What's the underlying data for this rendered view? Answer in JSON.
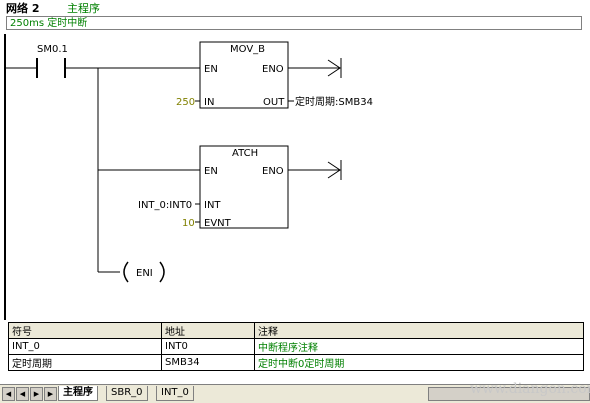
{
  "network": {
    "label": "网络 2",
    "name": "主程序",
    "comment": "250ms 定时中断"
  },
  "rungs": {
    "contact": "SM0.1",
    "mov": {
      "title": "MOV_B",
      "en": "EN",
      "eno": "ENO",
      "in": "IN",
      "out": "OUT",
      "in_value": "250",
      "out_value": "定时周期:SMB34"
    },
    "atch": {
      "title": "ATCH",
      "en": "EN",
      "eno": "ENO",
      "int": "INT",
      "evnt": "EVNT",
      "int_value": "INT_0:INT0",
      "evnt_value": "10"
    },
    "eni": "ENI"
  },
  "symbol_table": {
    "headers": [
      "符号",
      "地址",
      "注释"
    ],
    "rows": [
      [
        "INT_0",
        "INT0",
        "中断程序注释"
      ],
      [
        "定时周期",
        "SMB34",
        "定时中断0定时周期"
      ]
    ]
  },
  "tabs": [
    "主程序",
    "SBR_0",
    "INT_0"
  ],
  "watermark": "www.diangon.com",
  "colors": {
    "comment": "#008000",
    "constant": "#808000",
    "rail": "#000000"
  }
}
